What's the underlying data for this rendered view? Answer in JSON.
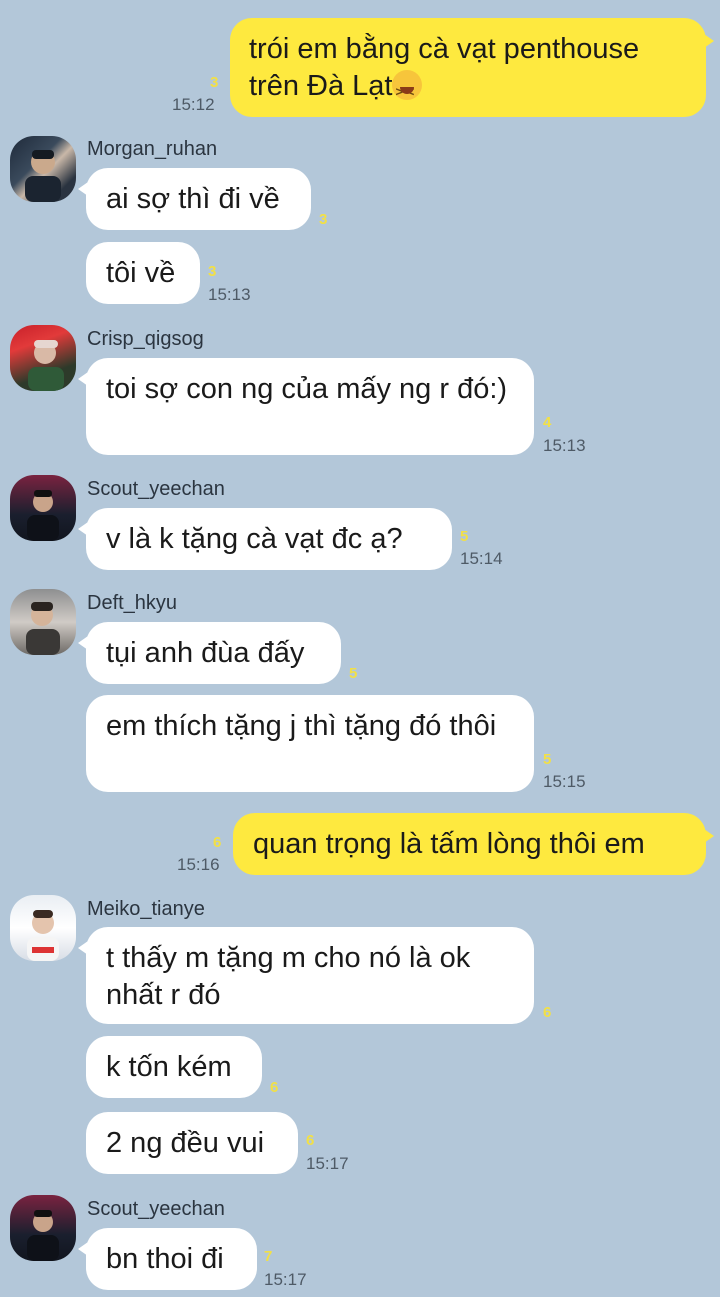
{
  "messages": [
    {
      "kind": "out",
      "text": "trói em bằng cà vạt penthouse trên Đà Lạt",
      "unread": "3",
      "time": "15:12"
    },
    {
      "kind": "in",
      "user": "Morgan_ruhan",
      "texts": [
        "ai sợ thì đi về",
        "tôi về"
      ],
      "unread": [
        "3",
        "3"
      ],
      "time": "15:13"
    },
    {
      "kind": "in",
      "user": "Crisp_qigsog",
      "texts": [
        "toi sợ con ng của mấy ng r đó:)"
      ],
      "unread": [
        "4"
      ],
      "time": "15:13"
    },
    {
      "kind": "in",
      "user": "Scout_yeechan",
      "texts": [
        "v là k tặng cà vạt đc ạ?"
      ],
      "unread": [
        "5"
      ],
      "time": "15:14"
    },
    {
      "kind": "in",
      "user": "Deft_hkyu",
      "texts": [
        "tụi anh đùa đấy",
        "em thích tặng j thì tặng đó thôi"
      ],
      "unread": [
        "5",
        "5"
      ],
      "time": "15:15"
    },
    {
      "kind": "out",
      "text": "quan trọng là tấm lòng thôi em",
      "unread": "6",
      "time": "15:16"
    },
    {
      "kind": "in",
      "user": "Meiko_tianye",
      "texts": [
        "t thấy m tặng m cho nó là ok nhất r đó",
        "k tốn kém",
        "2 ng đều vui"
      ],
      "unread": [
        "6",
        "6",
        "6"
      ],
      "time": "15:17"
    },
    {
      "kind": "in",
      "user": "Scout_yeechan",
      "texts": [
        "bn thoi đi"
      ],
      "unread": [
        "7"
      ],
      "time": "15:17"
    }
  ],
  "avatars": [
    "player-avatar-icon"
  ],
  "colors": {
    "background": "#b3c7d9",
    "outgoing": "#fee93f",
    "incoming": "#ffffff",
    "unread": "#f2e046"
  }
}
